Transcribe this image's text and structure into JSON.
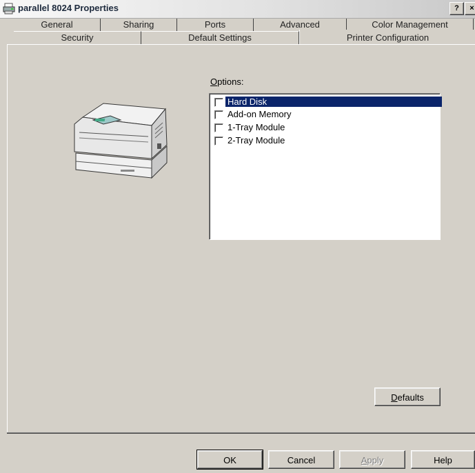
{
  "window": {
    "title": "parallel 8024 Properties",
    "help_glyph": "?",
    "close_glyph": "×"
  },
  "tabs": {
    "row1": [
      "General",
      "Sharing",
      "Ports",
      "Advanced",
      "Color Management"
    ],
    "row2": [
      "Security",
      "Default Settings",
      "Printer Configuration"
    ],
    "selected": "Printer Configuration"
  },
  "options": {
    "label_prefix": "",
    "label_accel": "O",
    "label_rest": "ptions:",
    "items": [
      {
        "label": "Hard Disk",
        "checked": false,
        "selected": true
      },
      {
        "label": "Add-on Memory",
        "checked": false,
        "selected": false
      },
      {
        "label": "1-Tray Module",
        "checked": false,
        "selected": false
      },
      {
        "label": "2-Tray Module",
        "checked": false,
        "selected": false
      }
    ]
  },
  "buttons": {
    "defaults_accel": "D",
    "defaults_rest": "efaults",
    "ok": "OK",
    "cancel": "Cancel",
    "apply_accel": "A",
    "apply_rest": "pply",
    "help": "Help"
  },
  "colors": {
    "selection": "#0a246a",
    "face": "#d4d0c8"
  }
}
